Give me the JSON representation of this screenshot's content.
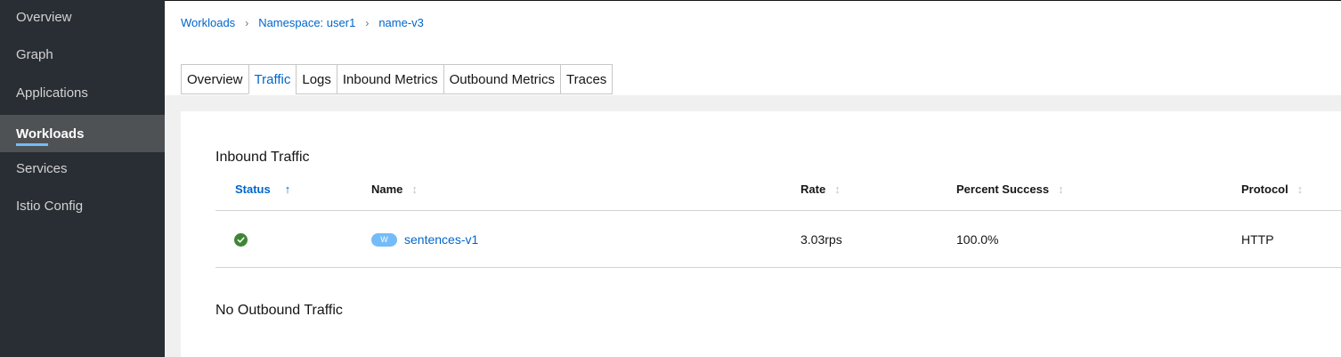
{
  "sidebar": {
    "items": [
      {
        "label": "Overview"
      },
      {
        "label": "Graph"
      },
      {
        "label": "Applications"
      },
      {
        "label": "Workloads",
        "active": true
      },
      {
        "label": "Services"
      },
      {
        "label": "Istio Config"
      }
    ]
  },
  "breadcrumb": {
    "items": [
      "Workloads",
      "Namespace: user1",
      "name-v3"
    ],
    "separator": "›"
  },
  "tabs": [
    "Overview",
    "Traffic",
    "Logs",
    "Inbound Metrics",
    "Outbound Metrics",
    "Traces"
  ],
  "active_tab": "Traffic",
  "inbound": {
    "title": "Inbound Traffic",
    "columns": {
      "status": "Status",
      "name": "Name",
      "rate": "Rate",
      "percent_success": "Percent Success",
      "protocol": "Protocol"
    },
    "sort_icon_active": "↑",
    "sort_icon_inactive": "↕",
    "rows": [
      {
        "status": "healthy",
        "status_icon": "check-circle-icon",
        "badge": "W",
        "name": "sentences-v1",
        "rate": "3.03rps",
        "percent_success": "100.0%",
        "protocol": "HTTP"
      }
    ]
  },
  "outbound": {
    "title": "No Outbound Traffic"
  },
  "colors": {
    "sidebar_bg": "#292e34",
    "sidebar_active_bg": "#4f5255",
    "active_indicator": "#73bcf7",
    "link": "#0066cc",
    "success": "#3e8635",
    "badge": "#73bcf7"
  }
}
